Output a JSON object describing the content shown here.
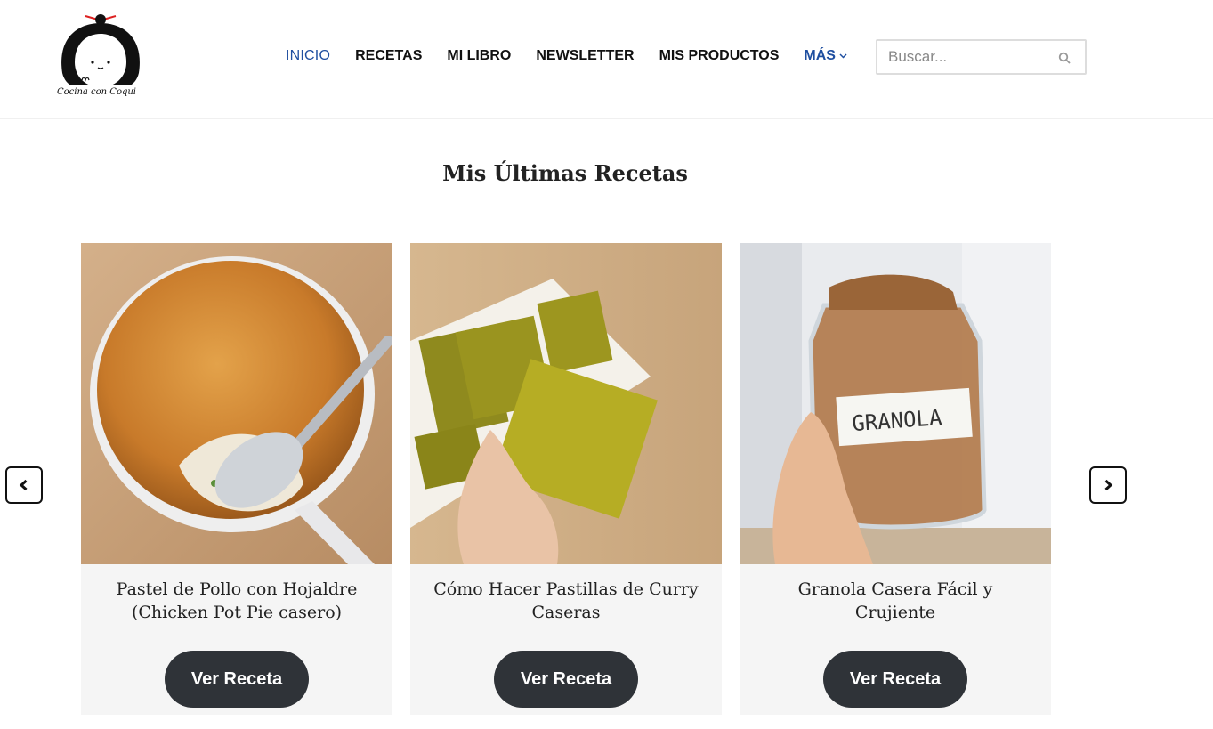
{
  "header": {
    "logo_text": "Cocina con Coqui",
    "nav": [
      {
        "label": "INICIO"
      },
      {
        "label": "RECETAS"
      },
      {
        "label": "MI LIBRO"
      },
      {
        "label": "NEWSLETTER"
      },
      {
        "label": "MIS PRODUCTOS"
      },
      {
        "label": "MÁS"
      }
    ],
    "search": {
      "placeholder": "Buscar..."
    }
  },
  "main": {
    "section_title": "Mis Últimas Recetas",
    "cards": [
      {
        "title": "Pastel de Pollo con Hojaldre (Chicken Pot Pie casero)",
        "button": "Ver Receta",
        "image": "chicken-pot-pie-image"
      },
      {
        "title": "Cómo Hacer Pastillas de Curry Caseras",
        "button": "Ver Receta",
        "image": "curry-blocks-image"
      },
      {
        "title": "Granola Casera Fácil y Crujiente",
        "button": "Ver Receta",
        "image": "granola-jar-image",
        "jar_label": "GRANOLA"
      }
    ]
  },
  "colors": {
    "accent": "#1f4fa0",
    "button_bg": "#2f3338",
    "card_bg": "#f5f5f5"
  },
  "icons": {
    "search": "search-icon",
    "prev": "chevron-left-icon",
    "next": "chevron-right-icon",
    "more": "chevron-down-icon"
  }
}
